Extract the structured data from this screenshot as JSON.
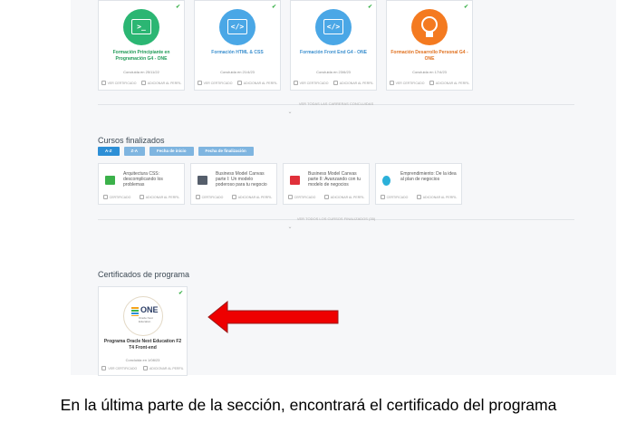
{
  "completed_trainings": [
    {
      "title": "Formación Principiante en Programación G4 - ONE",
      "date": "Concluida en 25/11/22",
      "color": "#2bb673",
      "icon": ">_",
      "title_color": "#1e9a56"
    },
    {
      "title": "Formación HTML & CSS",
      "date": "Concluida en 21/4/23",
      "color": "#4aa7e6",
      "icon": "</>",
      "title_color": "#3b8fce"
    },
    {
      "title": "Formación Front End G4 - ONE",
      "date": "Concluida en 23/6/23",
      "color": "#4aa7e6",
      "icon": "</>",
      "title_color": "#3b8fce"
    },
    {
      "title": "Formación Desarrollo Personal G4 - ONE",
      "date": "Concluida en 17/4/23",
      "color": "#f47a20",
      "icon": "bulb",
      "title_color": "#e0701e"
    }
  ],
  "card_actions": {
    "certificate": "VER CERTIFICADO",
    "profile": "ADICIONAR AL PERFIL",
    "certificate_short": "CERTIFICADO"
  },
  "see_all_trainings": "VER TODAS LAS CARRERAS CONCLUIDAS",
  "finished_courses": {
    "title": "Cursos finalizados",
    "filters": [
      "A-Z",
      "Z-A",
      "Fecha de inicio",
      "Fecha de finalización"
    ],
    "courses": [
      {
        "title": "Arquitectura CSS: descomplicando los problemas",
        "color": "#3bb14a"
      },
      {
        "title": "Business Model Canvas parte I: Un modelo poderoso para tu negocio",
        "color": "#555e6b"
      },
      {
        "title": "Business Model Canvas parte II: Avanzando con tu modelo de negocios",
        "color": "#e0303a"
      },
      {
        "title": "Emprendimiento: De la idea al plan de negocios",
        "color": "#2bb0d9"
      }
    ],
    "see_all": "VER TODOS LOS CURSOS FINALIZADOS (35)"
  },
  "program_certificates": {
    "title": "Certificados de programa",
    "card": {
      "logo": "ONE",
      "logo_sub": "Oracle Next Education",
      "title": "Programa Oracle Next Education F2 T4 Front-end",
      "date": "Concluida en 1/08/23"
    }
  },
  "caption": "En la última parte de la sección, encontrará el certificado del programa",
  "colors": {
    "arrow": "#ee0000",
    "tick": "#3bb14a",
    "active_filter": "#2d8fd6"
  }
}
